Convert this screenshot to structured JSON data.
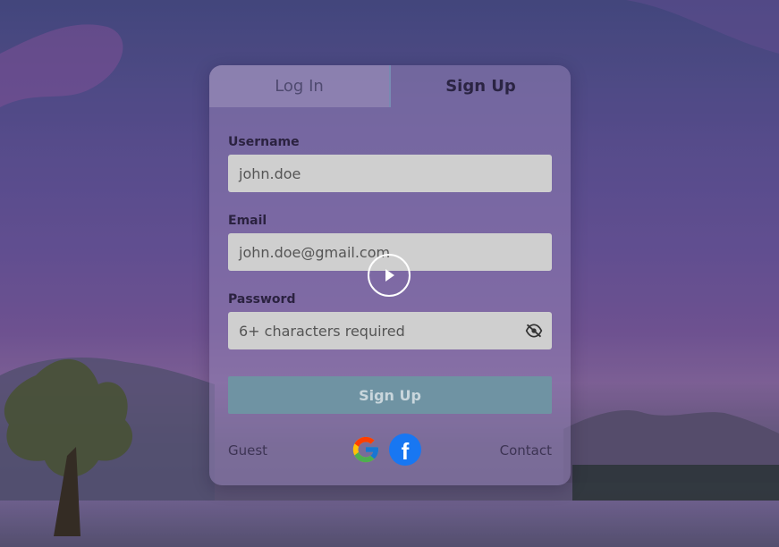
{
  "tabs": [
    {
      "label": "Log In",
      "active": false
    },
    {
      "label": "Sign Up",
      "active": true
    }
  ],
  "form": {
    "username_label": "Username",
    "username_value": "john.doe",
    "email_label": "Email",
    "email_value": "john.doe@gmail.com",
    "password_label": "Password",
    "password_placeholder": "6+ characters required",
    "submit_label": "Sign Up"
  },
  "footer": {
    "guest_label": "Guest",
    "contact_label": "Contact",
    "social_icons": [
      "google-icon",
      "facebook-icon"
    ]
  },
  "colors": {
    "accent": "#6f93a3",
    "field_bg": "#cfcfcf",
    "facebook": "#1877f2"
  },
  "overlay": {
    "icon": "play-icon"
  }
}
